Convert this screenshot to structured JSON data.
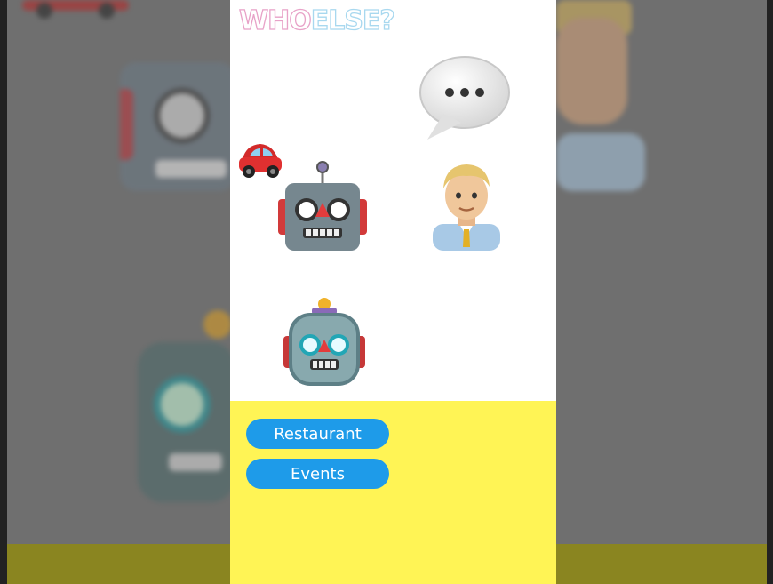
{
  "app": {
    "logo_text_1": "WHO",
    "logo_text_2": "ELSE?"
  },
  "buttons": {
    "restaurant_label": "Restaurant",
    "events_label": "Events"
  },
  "emojis": {
    "speech": "speech-bubble-icon",
    "car": "red-car-icon",
    "robot1": "robot-face-icon",
    "man": "businessman-icon",
    "robot2": "robot-icon"
  },
  "colors": {
    "bottom_panel": "#fff455",
    "button": "#1e9be9",
    "logo_pink": "#e8a2c8",
    "logo_blue": "#a8d8ef"
  }
}
